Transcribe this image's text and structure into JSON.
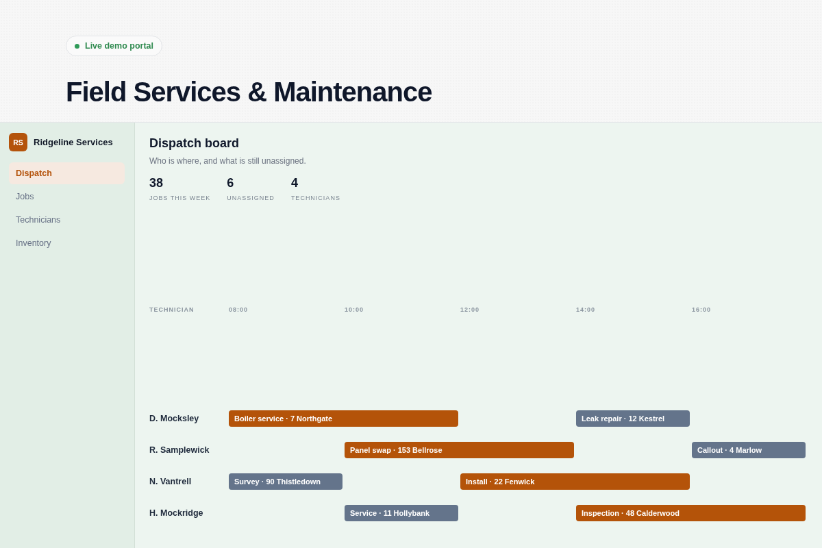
{
  "hero": {
    "badge": "Live demo portal",
    "title": "Field Services & Maintenance"
  },
  "sidebar": {
    "logo": "RS",
    "brand": "Ridgeline Services",
    "items": [
      {
        "label": "Dispatch",
        "selected": true
      },
      {
        "label": "Jobs",
        "selected": false
      },
      {
        "label": "Technicians",
        "selected": false
      },
      {
        "label": "Inventory",
        "selected": false
      }
    ]
  },
  "main": {
    "title": "Dispatch board",
    "subtitle": "Who is where, and what is still unassigned.",
    "stats": [
      {
        "value": "38",
        "label": "JOBS THIS WEEK"
      },
      {
        "value": "6",
        "label": "UNASSIGNED"
      },
      {
        "value": "4",
        "label": "TECHNICIANS"
      }
    ]
  },
  "board": {
    "column_label": "TECHNICIAN",
    "times": [
      "08:00",
      "10:00",
      "12:00",
      "14:00",
      "16:00"
    ],
    "rows": [
      {
        "name": "D. Mocksley",
        "slots": [
          {
            "kind": "job",
            "label": "Boiler service · 7 Northgate",
            "color": "#b45309"
          },
          {
            "kind": "continued"
          },
          {
            "kind": "empty"
          },
          {
            "kind": "job",
            "label": "Leak repair · 12 Kestrel",
            "color": "#64748b"
          },
          {
            "kind": "empty"
          }
        ]
      },
      {
        "name": "R. Samplewick",
        "slots": [
          {
            "kind": "empty"
          },
          {
            "kind": "job",
            "label": "Panel swap · 153 Bellrose",
            "color": "#b45309"
          },
          {
            "kind": "continued"
          },
          {
            "kind": "empty"
          },
          {
            "kind": "job",
            "label": "Callout · 4 Marlow",
            "color": "#64748b"
          }
        ]
      },
      {
        "name": "N. Vantrell",
        "slots": [
          {
            "kind": "job",
            "label": "Survey · 90 Thistledown",
            "color": "#64748b"
          },
          {
            "kind": "empty"
          },
          {
            "kind": "job",
            "label": "Install · 22 Fenwick",
            "color": "#b45309"
          },
          {
            "kind": "continued"
          },
          {
            "kind": "empty"
          }
        ]
      },
      {
        "name": "H. Mockridge",
        "slots": [
          {
            "kind": "empty"
          },
          {
            "kind": "job",
            "label": "Service · 11 Hollybank",
            "color": "#64748b"
          },
          {
            "kind": "empty"
          },
          {
            "kind": "job",
            "label": "Inspection · 48 Calderwood",
            "color": "#b45309"
          },
          {
            "kind": "continued"
          }
        ]
      }
    ]
  }
}
